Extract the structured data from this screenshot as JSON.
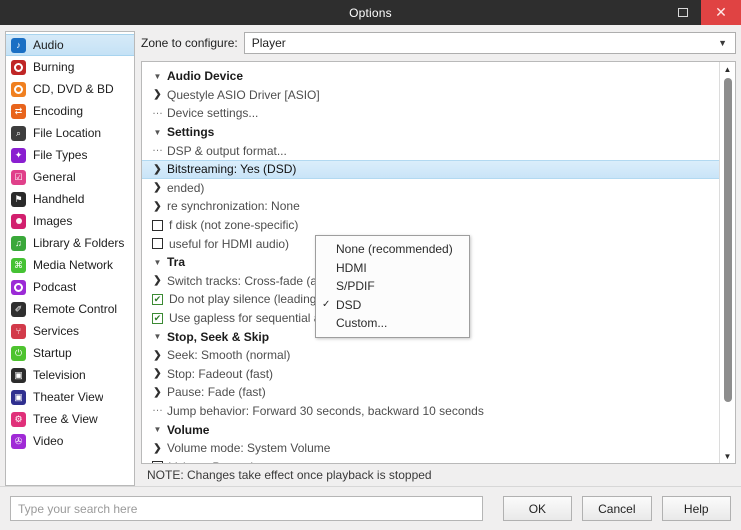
{
  "titlebar": {
    "title": "Options",
    "maximize_label": "",
    "close_label": "✕"
  },
  "sidebar": {
    "items": [
      {
        "label": "Audio",
        "icon": "music-note-icon",
        "color": "#1a6fc4",
        "glyph": "♪",
        "selected": true
      },
      {
        "label": "Burning",
        "icon": "disc-burn-icon",
        "color": "#c02626",
        "glyph": "",
        "selected": false
      },
      {
        "label": "CD, DVD & BD",
        "icon": "optical-disc-icon",
        "color": "#f08020",
        "glyph": "",
        "selected": false
      },
      {
        "label": "Encoding",
        "icon": "encoding-arrows-icon",
        "color": "#e8641c",
        "glyph": "⇄",
        "selected": false
      },
      {
        "label": "File Location",
        "icon": "folder-search-icon",
        "color": "#3d3d3d",
        "glyph": "⌕",
        "selected": false
      },
      {
        "label": "File Types",
        "icon": "puzzle-piece-icon",
        "color": "#8a1fd0",
        "glyph": "✦",
        "selected": false
      },
      {
        "label": "General",
        "icon": "checkbox-pink-icon",
        "color": "#e0408a",
        "glyph": "☑",
        "selected": false
      },
      {
        "label": "Handheld",
        "icon": "handheld-device-icon",
        "color": "#2a2a2a",
        "glyph": "⚑",
        "selected": false
      },
      {
        "label": "Images",
        "icon": "camera-icon",
        "color": "#d21f6e",
        "glyph": "",
        "selected": false
      },
      {
        "label": "Library & Folders",
        "icon": "library-note-icon",
        "color": "#3aa83a",
        "glyph": "♫",
        "selected": false
      },
      {
        "label": "Media Network",
        "icon": "network-share-icon",
        "color": "#45c233",
        "glyph": "⌘",
        "selected": false
      },
      {
        "label": "Podcast",
        "icon": "podcast-icon",
        "color": "#9b2ad6",
        "glyph": "",
        "selected": false
      },
      {
        "label": "Remote Control",
        "icon": "remote-control-icon",
        "color": "#2f2f2f",
        "glyph": "✐",
        "selected": false
      },
      {
        "label": "Services",
        "icon": "plug-icon",
        "color": "#d23a4a",
        "glyph": "⑂",
        "selected": false
      },
      {
        "label": "Startup",
        "icon": "power-icon",
        "color": "#4ec32f",
        "glyph": "⏻",
        "selected": false
      },
      {
        "label": "Television",
        "icon": "television-icon",
        "color": "#2b2b2b",
        "glyph": "▣",
        "selected": false
      },
      {
        "label": "Theater View",
        "icon": "theater-screen-icon",
        "color": "#2f2f8f",
        "glyph": "▣",
        "selected": false
      },
      {
        "label": "Tree & View",
        "icon": "gear-pink-icon",
        "color": "#e0307a",
        "glyph": "⚙",
        "selected": false
      },
      {
        "label": "Video",
        "icon": "film-camera-icon",
        "color": "#a02ad6",
        "glyph": "✇",
        "selected": false
      }
    ]
  },
  "zone": {
    "label": "Zone to configure:",
    "value": "Player",
    "arrow": "▼"
  },
  "tree": {
    "rows": [
      {
        "kind": "group",
        "widget": "▼",
        "text": "Audio Device"
      },
      {
        "kind": "chevron",
        "widget": "❯",
        "text": "Questyle ASIO Driver [ASIO]"
      },
      {
        "kind": "dots",
        "widget": "…",
        "text": "Device settings..."
      },
      {
        "kind": "group",
        "widget": "▼",
        "text": "Settings"
      },
      {
        "kind": "dots",
        "widget": "…",
        "text": "DSP & output format..."
      },
      {
        "kind": "chevron",
        "widget": "❯",
        "text": "Bitstreaming: Yes (DSD)",
        "selected": true
      },
      {
        "kind": "chevron",
        "widget": "❯",
        "text": "ended)",
        "obscured": true
      },
      {
        "kind": "chevron",
        "widget": "❯",
        "text": "re synchronization: None",
        "obscured": true
      },
      {
        "kind": "checkbox",
        "checked": false,
        "text": "f disk (not zone-specific)",
        "obscured": true
      },
      {
        "kind": "checkbox",
        "checked": false,
        "text": "useful for HDMI audio)",
        "obscured": true
      },
      {
        "kind": "group",
        "widget": "▼",
        "text": "Tra"
      },
      {
        "kind": "chevron",
        "widget": "❯",
        "text": "Switch tracks: Cross-fade (aggressive) - 4s"
      },
      {
        "kind": "checkbox",
        "checked": true,
        "text": "Do not play silence (leading and trailing)"
      },
      {
        "kind": "checkbox",
        "checked": true,
        "text": "Use gapless for sequential album tracks"
      },
      {
        "kind": "group",
        "widget": "▼",
        "text": "Stop, Seek & Skip"
      },
      {
        "kind": "chevron",
        "widget": "❯",
        "text": "Seek: Smooth (normal)"
      },
      {
        "kind": "chevron",
        "widget": "❯",
        "text": "Stop: Fadeout (fast)"
      },
      {
        "kind": "chevron",
        "widget": "❯",
        "text": "Pause: Fade (fast)"
      },
      {
        "kind": "dots",
        "widget": "…",
        "text": "Jump behavior: Forward 30 seconds, backward 10 seconds"
      },
      {
        "kind": "group",
        "widget": "▼",
        "text": "Volume"
      },
      {
        "kind": "chevron",
        "widget": "❯",
        "text": "Volume mode: System Volume"
      },
      {
        "kind": "checkbox",
        "checked": false,
        "text": "Volume Protection"
      }
    ]
  },
  "dropdown": {
    "items": [
      {
        "label": "None (recommended)",
        "checked": false
      },
      {
        "label": "HDMI",
        "checked": false
      },
      {
        "label": "S/PDIF",
        "checked": false
      },
      {
        "label": "DSD",
        "checked": true
      },
      {
        "label": "Custom...",
        "checked": false
      }
    ],
    "check_glyph": "✓"
  },
  "scrollbar": {
    "up_arrow": "▲",
    "down_arrow": "▼"
  },
  "note": {
    "text": "NOTE: Changes take effect once playback is stopped"
  },
  "footer": {
    "search_placeholder": "Type your search here",
    "search_value": "",
    "ok_label": "OK",
    "cancel_label": "Cancel",
    "help_label": "Help"
  }
}
